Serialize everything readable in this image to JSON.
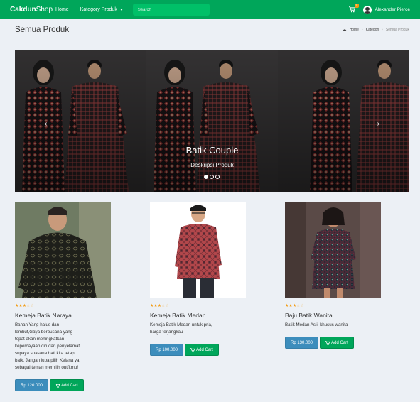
{
  "navbar": {
    "brand_bold": "Cakdun",
    "brand_rest": "Shop",
    "home": "Home",
    "kategori": "Kategory Produk",
    "search_placeholder": "Search",
    "cart_count": "3",
    "user_name": "Alexander Pierce"
  },
  "header": {
    "title": "Semua Produk",
    "breadcrumb": [
      "Home",
      "Kategori",
      "Semua Produk"
    ]
  },
  "carousel": {
    "caption_title": "Batik Couple",
    "caption_desc": "Deskripsi Produk",
    "prev": "‹",
    "next": "›",
    "slides": 3,
    "active_slide": 1
  },
  "products": [
    {
      "name": "Kemeja Batik Naraya",
      "rating": 3,
      "description": [
        "Bahan Yang halus dan",
        "lembut,Gaya berbusana yang",
        "tepat akan meningkatkan",
        "kepercayaan diri dan penyelamat",
        "supaya suasana hati kita tetap",
        "baik. Jangan lupa pilih Kelana ya",
        "sebagai teman memilih outfitmu!"
      ],
      "price": "Rp 120.000",
      "cart_label": "Add Cart"
    },
    {
      "name": "Kemeja Batik Medan",
      "rating": 3,
      "description": [
        "Kemeja Batik Medan untuk pria,",
        "harga terjangkau"
      ],
      "price": "Rp 100.000",
      "cart_label": "Add Cart"
    },
    {
      "name": "Baju Batik Wanita",
      "rating": 3,
      "description": [
        "Batik Medan Asli, khusus wanita"
      ],
      "price": "Rp 130.000",
      "cart_label": "Add Cart"
    }
  ]
}
